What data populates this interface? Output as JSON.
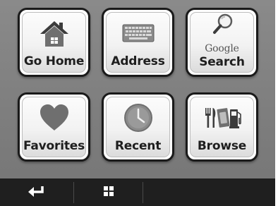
{
  "tiles": [
    {
      "name": "go-home",
      "label": "Go Home",
      "icon": "house-icon"
    },
    {
      "name": "address",
      "label": "Address",
      "icon": "keyboard-icon"
    },
    {
      "name": "google-search",
      "label_line1": "Google",
      "label_line2": "Search",
      "icon": "magnifier-icon"
    },
    {
      "name": "favorites",
      "label": "Favorites",
      "icon": "heart-icon"
    },
    {
      "name": "recent",
      "label": "Recent",
      "icon": "clock-icon"
    },
    {
      "name": "browse",
      "label": "Browse",
      "icon": "poi-icon"
    }
  ],
  "bottom_bar": {
    "back_icon": "back-arrow-icon",
    "grid_icon": "grid-icon"
  },
  "colors": {
    "background": "#808080",
    "tile_border": "#1a1a1a",
    "icon_gray": "#6f6f6f",
    "bar": "#1f1f1f"
  }
}
